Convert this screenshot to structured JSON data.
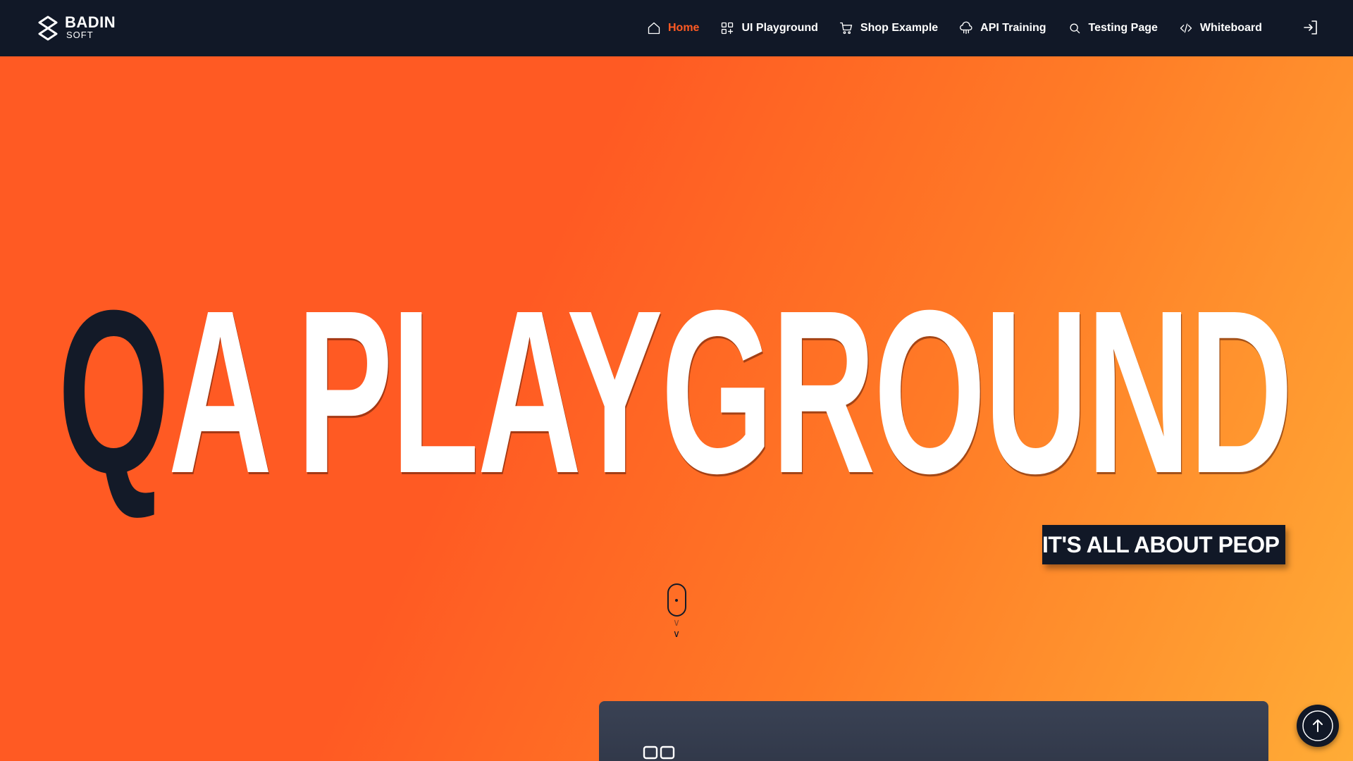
{
  "brand": {
    "name": "BADIN",
    "sub": "SOFT"
  },
  "nav": {
    "items": [
      {
        "label": "Home",
        "icon": "home-icon",
        "active": true
      },
      {
        "label": "UI Playground",
        "icon": "apps-add-icon",
        "active": false
      },
      {
        "label": "Shop Example",
        "icon": "cart-icon",
        "active": false
      },
      {
        "label": "API Training",
        "icon": "cloud-network-icon",
        "active": false
      },
      {
        "label": "Testing Page",
        "icon": "search-icon",
        "active": false
      },
      {
        "label": "Whiteboard",
        "icon": "code-icon",
        "active": false
      }
    ],
    "login_icon": "login-icon"
  },
  "hero": {
    "title_dark": "Q",
    "title_white_1": "A",
    "title_white_2": "PLAYGROUND",
    "tagline": "IT'S ALL ABOUT PEOP"
  },
  "colors": {
    "accent": "#ff5a23",
    "dark": "#111827",
    "gradient_end": "#ffac36"
  },
  "scroll_indicator_icon": "mouse-scroll-icon",
  "back_to_top_icon": "arrow-up-icon",
  "card_icon": "two-boxes-icon"
}
